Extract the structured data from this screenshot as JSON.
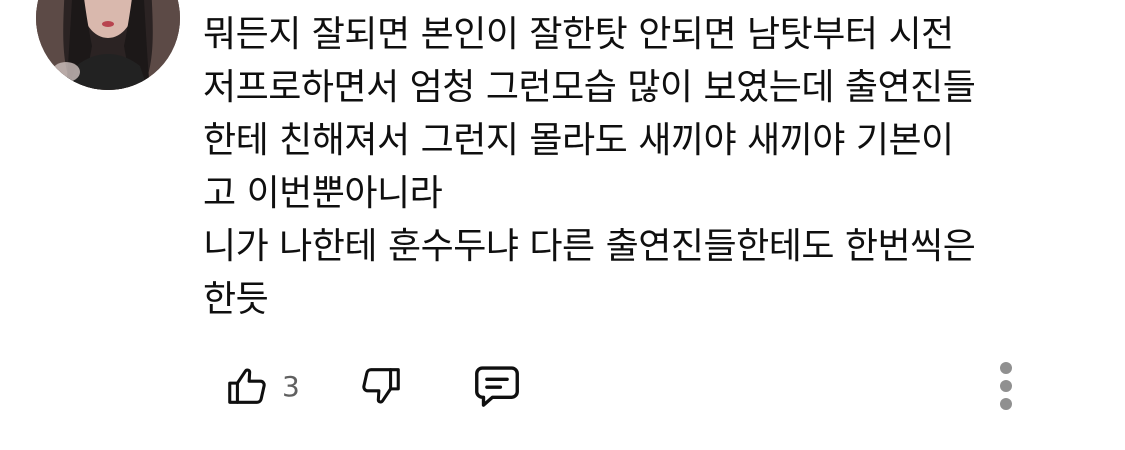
{
  "comment": {
    "lines": [
      "뭐든지 잘되면 본인이 잘한탓 안되면 남탓부터 시전",
      "저프로하면서 엄청 그런모습 많이 보였는데 출연진들",
      "한테 친해져서 그런지 몰라도 새끼야 새끼야 기본이",
      "고 이번뿐아니라",
      "니가 나한테 훈수두냐 다른 출연진들한테도 한번씩은",
      "한듯"
    ]
  },
  "actions": {
    "like_count": "3",
    "icons": {
      "like": "thumbs-up-icon",
      "dislike": "thumbs-down-icon",
      "reply": "comment-icon",
      "more": "more-vertical-icon"
    }
  },
  "colors": {
    "text": "#0f0f0f",
    "secondary_text": "#606060",
    "icon": "#0f0f0f",
    "more_icon": "#909090"
  }
}
